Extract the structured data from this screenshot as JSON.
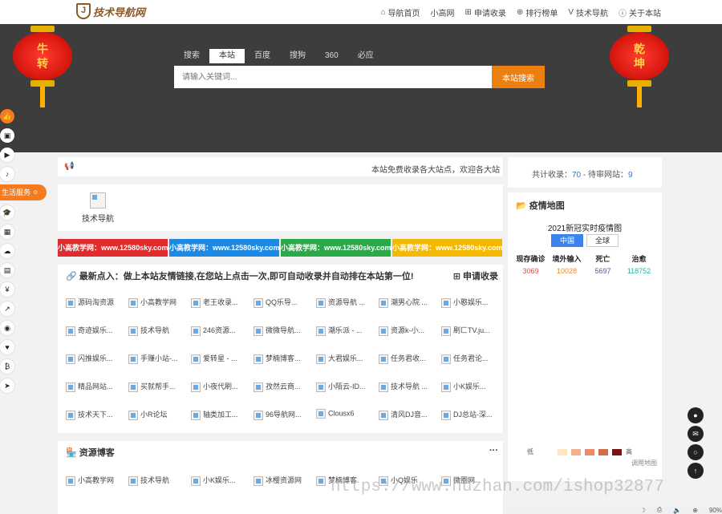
{
  "header": {
    "logo_text": "技术导航网",
    "nav": [
      {
        "icon": "home-icon",
        "glyph": "⌂",
        "label": "导航首页"
      },
      {
        "icon": "",
        "glyph": "",
        "label": "小高网"
      },
      {
        "icon": "plus-square-icon",
        "glyph": "⊞",
        "label": "申请收录"
      },
      {
        "icon": "ranking-icon",
        "glyph": "⊕",
        "label": "排行榜单"
      },
      {
        "icon": "v-icon",
        "glyph": "V",
        "label": "技术导航"
      },
      {
        "icon": "info-icon",
        "glyph": "ⓘ",
        "label": "关于本站"
      }
    ]
  },
  "hero": {
    "lantern_left": [
      "牛",
      "转"
    ],
    "lantern_right": [
      "乾",
      "坤"
    ],
    "search_tabs": [
      "搜索",
      "本站",
      "百度",
      "搜狗",
      "360",
      "必应"
    ],
    "active_tab": "本站",
    "search_placeholder": "请输入关键词...",
    "search_button": "本站搜索"
  },
  "sidebar": {
    "life_label": "生活服务",
    "icons_top": [
      "thumbs-up-icon",
      "shop-icon",
      "youtube-icon",
      "music-icon"
    ],
    "icons_bottom": [
      "graduation-cap-icon",
      "grid-icon",
      "cloud-icon",
      "file-icon",
      "yen-icon",
      "chart-icon",
      "compass-icon",
      "heartbeat-icon",
      "bitcoin-icon",
      "send-icon"
    ]
  },
  "notice": {
    "text": "本站免费收录各大站点，欢迎各大站"
  },
  "featured": {
    "label": "技术导航"
  },
  "banners": [
    {
      "text": "小高教学网：www.12580sky.com",
      "color": "#e02c2c"
    },
    {
      "text": "小高教学网：www.12580sky.com",
      "color": "#1e88e5"
    },
    {
      "text": "小高教学网：www.12580sky.com",
      "color": "#2aa84a"
    },
    {
      "text": "小高教学网：www.12580sky.com",
      "color": "#f5b800"
    }
  ],
  "latest": {
    "title": "最新点入：做上本站友情链接,在您站上点击一次,即可自动收录并自动排在本站第一位!",
    "apply": "申请收录",
    "items": [
      "源码淘资源",
      "小高教学网",
      "老王收录...",
      "QQ乐导...",
      "资源导航 ...",
      "潮男心院 ...",
      "小憨娱乐...",
      "奇迹娱乐...",
      "技术导航",
      "246资源...",
      "微微导航...",
      "潮乐派 - ...",
      "资源k-小...",
      "刷匚TV.ju...",
      "闪推娱乐...",
      "手赚小站-...",
      "爱转星 - ...",
      "梦楠博客...",
      "大君娱乐...",
      "任务君收...",
      "任务君论...",
      "精品网站...",
      "买就帮手...",
      "小夜代刷...",
      "孜然云商...",
      "小陌云-ID...",
      "技术导航 ...",
      "小K娱乐...",
      "技术天下...",
      "小R论坛",
      "轴类加工...",
      "96导航网...",
      "Clousx6",
      "清风DJ音...",
      "DJ总站-深..."
    ]
  },
  "resources": {
    "title": "资源博客",
    "more": "···",
    "items": [
      "小高教学网",
      "技术导航",
      "小K娱乐...",
      "冰樱资源网",
      "梦楠博客",
      "小Q娱乐",
      "微圈网"
    ]
  },
  "stats": {
    "prefix": "共计收录：",
    "total": "70",
    "mid": " - 待审网站：",
    "pending": "9"
  },
  "covid": {
    "header": "疫情地图",
    "title": "2021新冠实时疫情图",
    "tabs": [
      "中国",
      "全球"
    ],
    "cols": [
      {
        "label": "现存确诊",
        "value": "3069",
        "color": "#e24a3b"
      },
      {
        "label": "境外输入",
        "value": "10028",
        "color": "#f08a24"
      },
      {
        "label": "死亡",
        "value": "5697",
        "color": "#4a5b9c"
      },
      {
        "label": "治愈",
        "value": "118752",
        "color": "#23b5a4"
      }
    ],
    "legend_low": "低",
    "legend_high": "高",
    "legend_colors": [
      "#fde6c0",
      "#f4b08e",
      "#ec8a6c",
      "#d66d4a",
      "#7a1414"
    ],
    "map_link": "调用地图"
  },
  "watermark": "https://www.huzhan.com/ishop32877",
  "statusbar": {
    "zoom": "90%"
  }
}
